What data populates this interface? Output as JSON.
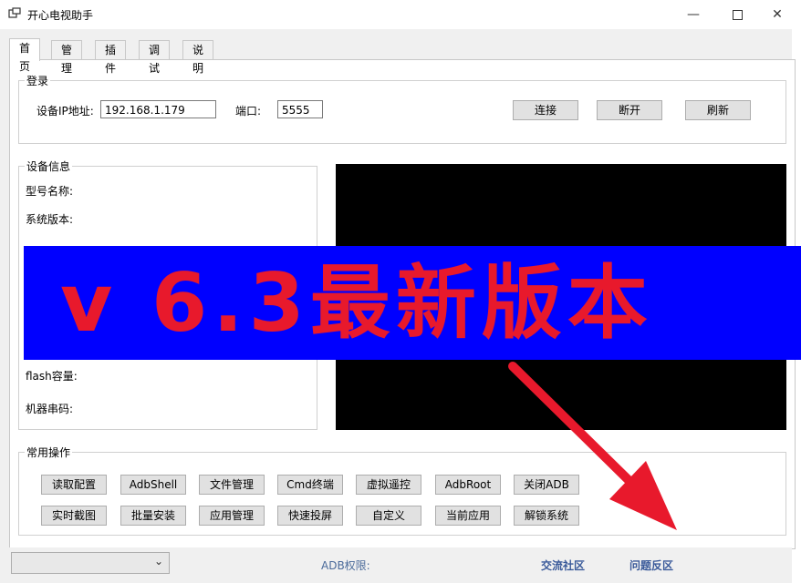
{
  "window": {
    "title": "开心电视助手",
    "icon": "app-icon",
    "min_icon": "minimize-icon",
    "max_icon": "maximize-icon",
    "close_icon": "close-icon"
  },
  "tabs": [
    {
      "label": "首页",
      "active": true
    },
    {
      "label": "管理"
    },
    {
      "label": "插件"
    },
    {
      "label": "调试"
    },
    {
      "label": "说明"
    }
  ],
  "login": {
    "legend": "登录",
    "ip_label": "设备IP地址:",
    "ip_value": "192.168.1.179",
    "port_label": "端口:",
    "port_value": "5555",
    "connect": "连接",
    "disconnect": "断开",
    "refresh": "刷新"
  },
  "device_info": {
    "legend": "设备信息",
    "model": "型号名称:",
    "system": "系统版本:",
    "flash": "flash容量:",
    "serial": "机器串码:"
  },
  "banner": {
    "text": "v 6.3最新版本",
    "bg_color": "#0000ff",
    "text_color": "#e8192c"
  },
  "operations": {
    "legend": "常用操作",
    "row1": [
      "读取配置",
      "AdbShell",
      "文件管理",
      "Cmd终端",
      "虚拟遥控",
      "AdbRoot",
      "关闭ADB"
    ],
    "row2": [
      "实时截图",
      "批量安装",
      "应用管理",
      "快速投屏",
      "自定义",
      "当前应用",
      "解锁系统"
    ]
  },
  "status": {
    "adb_label": "ADB权限:",
    "community": "交流社区",
    "feedback": "问题反区"
  },
  "colors": {
    "arrow": "#e8192c"
  }
}
